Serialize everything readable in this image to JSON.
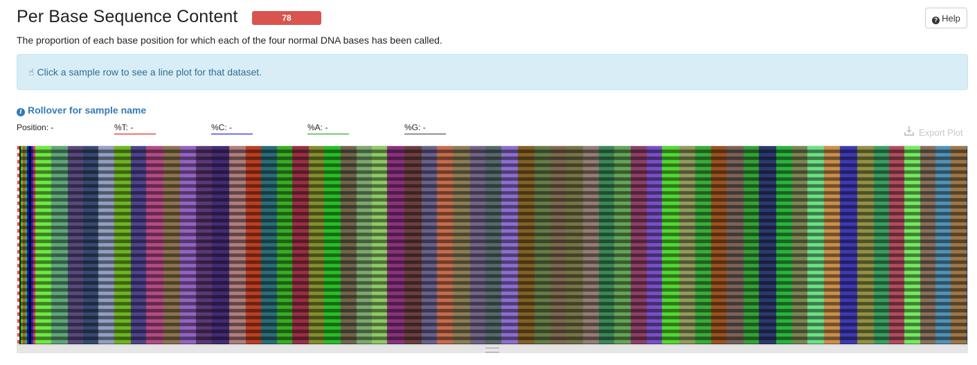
{
  "header": {
    "title": "Per Base Sequence Content",
    "badge": "78",
    "help_label": "Help"
  },
  "description": "The proportion of each base position for which each of the four normal DNA bases has been called.",
  "info": {
    "message": "Click a sample row to see a line plot for that dataset."
  },
  "rollover": {
    "label": "Rollover for sample name"
  },
  "readouts": {
    "position": "Position: -",
    "t": "%T: -",
    "c": "%C: -",
    "a": "%A: -",
    "g": "%G: -"
  },
  "export": {
    "label": "Export Plot"
  },
  "colors": {
    "t": "#dc0000",
    "c": "#0000dc",
    "a": "#00a000",
    "g": "#333333",
    "badge": "#d9534f",
    "info_bg": "#d9edf7",
    "link": "#337ab7"
  }
}
